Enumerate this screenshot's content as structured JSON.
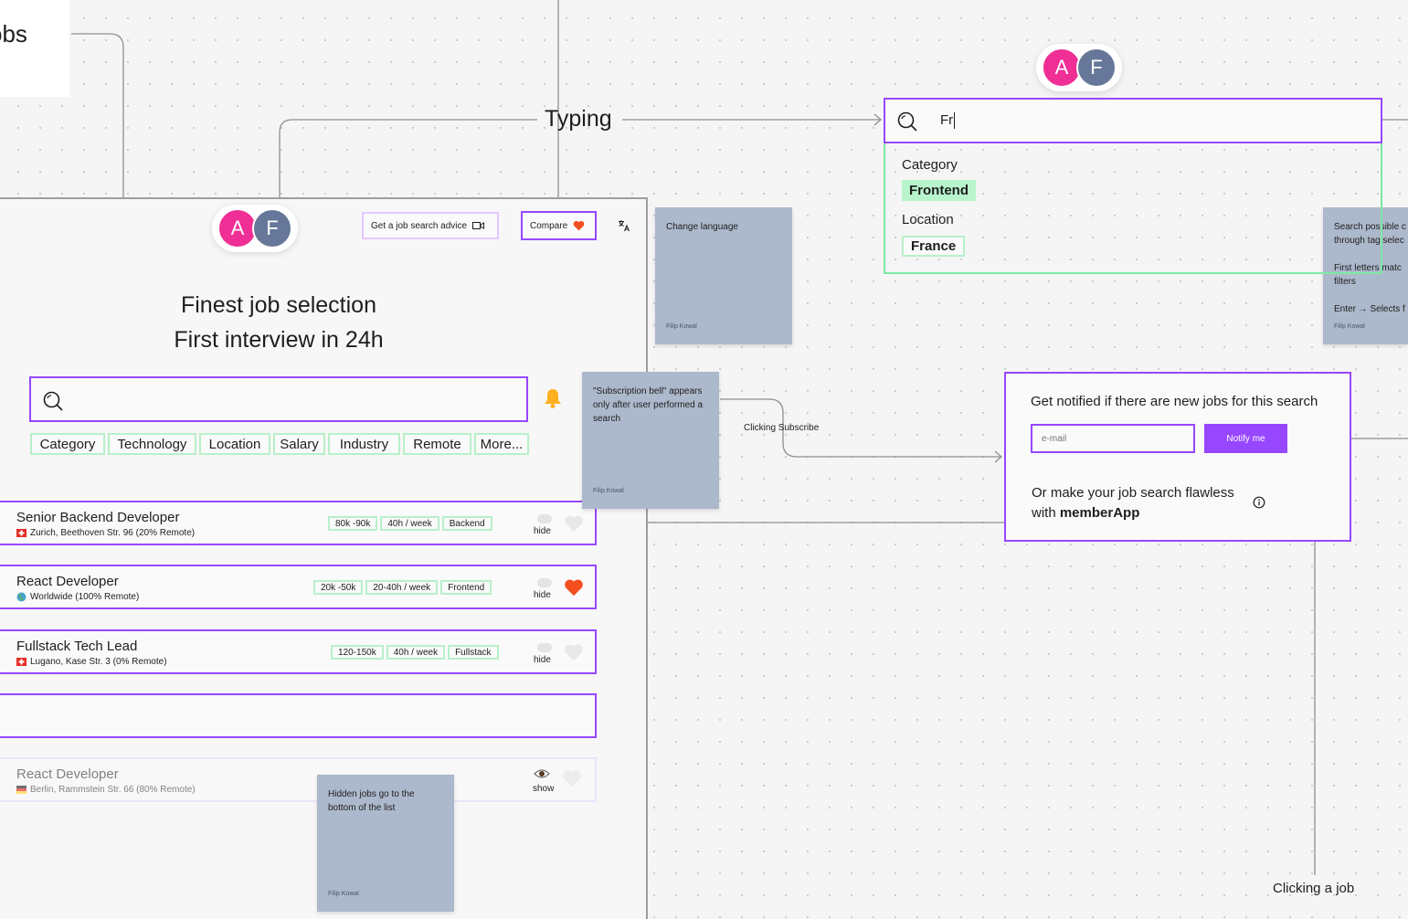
{
  "frames": {
    "top_left_title": "obs"
  },
  "annotations": {
    "typing": "Typing",
    "clicking_subscribe": "Clicking Subscribe",
    "clicking_a_job": "Clicking a job"
  },
  "avatars": {
    "a": "A",
    "f": "F"
  },
  "header": {
    "advice_button": "Get a job search advice",
    "compare_button": "Compare"
  },
  "hero": {
    "line1": "Finest job selection",
    "line2": "First interview in 24h"
  },
  "filters": [
    "Category",
    "Technology",
    "Location",
    "Salary",
    "Industry",
    "Remote",
    "More..."
  ],
  "jobs": [
    {
      "title": "Senior Backend Developer",
      "location": "Zurich, Beethoven Str. 96 (20% Remote)",
      "tags": [
        "80k -90k",
        "40h / week",
        "Backend"
      ],
      "action": "hide",
      "liked": false
    },
    {
      "title": "React Developer",
      "location": "Worldwide (100% Remote)",
      "tags": [
        "20k -50k",
        "20-40h / week",
        "Frontend"
      ],
      "action": "hide",
      "liked": true
    },
    {
      "title": "Fullstack Tech Lead",
      "location": "Lugano, Kase Str. 3 (0% Remote)",
      "tags": [
        "120-150k",
        "40h / week",
        "Fullstack"
      ],
      "action": "hide",
      "liked": false
    }
  ],
  "hidden_job": {
    "title": "React Developer",
    "location": "Berlin, Rammstein Str. 66 (80% Remote)",
    "action": "show"
  },
  "stickies": {
    "change_language": "Change language",
    "subscription_bell": "\"Subscription bell\" appears only after user performed a search",
    "hidden_jobs": "Hidden jobs go to the bottom of the list",
    "search_tags_1": "Search possible c through tag selec",
    "search_tags_2": "First letters matc filters",
    "search_tags_3": "Enter → Selects f",
    "author": "Filip Kowal"
  },
  "search_dropdown": {
    "query": "Fr",
    "category_label": "Category",
    "category_value": "Frontend",
    "location_label": "Location",
    "location_value": "France"
  },
  "notify": {
    "heading": "Get notified if there are new jobs for this search",
    "email_placeholder": "e-mail",
    "button": "Notify me",
    "line1": "Or make your job search flawless",
    "line2_prefix": "with ",
    "line2_brand": "memberApp"
  },
  "colors": {
    "accent": "#9747ff",
    "green_border": "#7ee8a2",
    "green_fill": "#b8f5cc",
    "sticky": "#acb8cb",
    "avatar_a": "#ef2f96",
    "avatar_f": "#667799",
    "heart": "#f24e1e",
    "bell": "#ffb020"
  }
}
